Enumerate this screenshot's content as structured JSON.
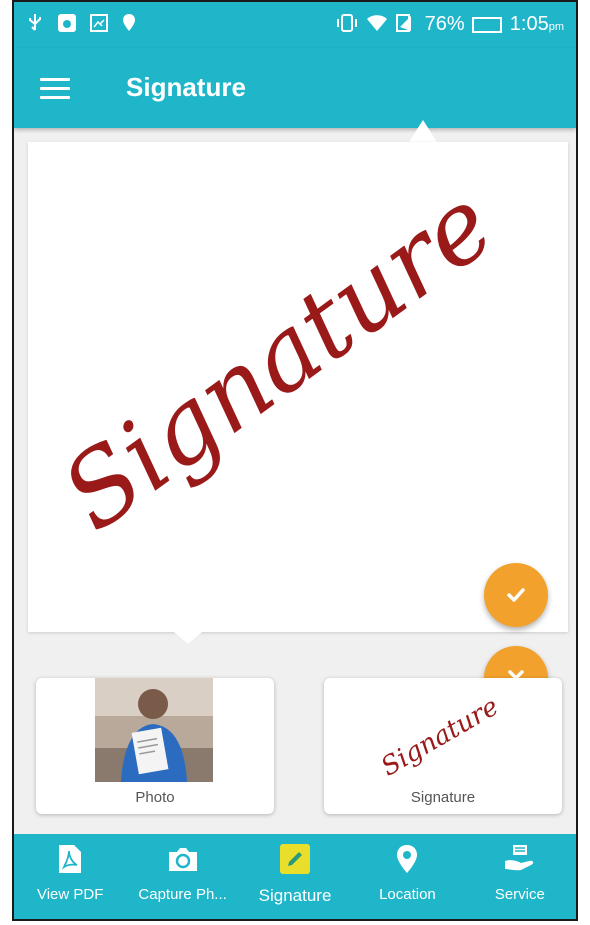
{
  "status_bar": {
    "battery": "76%",
    "time": "1:05",
    "ampm": "pm"
  },
  "toolbar": {
    "title": "Signature"
  },
  "signature_pad": {
    "signature_text": "Signature"
  },
  "thumbnails": [
    {
      "label": "Photo"
    },
    {
      "label": "Signature",
      "signature_text": "Signature"
    }
  ],
  "bottom_nav": {
    "items": [
      {
        "label": "View PDF",
        "icon": "pdf-icon"
      },
      {
        "label": "Capture Ph...",
        "icon": "camera-icon"
      },
      {
        "label": "Signature",
        "icon": "pencil-icon",
        "active": true
      },
      {
        "label": "Location",
        "icon": "location-pin-icon"
      },
      {
        "label": "Service",
        "icon": "service-hand-icon"
      }
    ]
  },
  "colors": {
    "primary": "#20b6ca",
    "fab": "#f2a22c",
    "active_icon": "#e9df2a",
    "signature_ink": "#9a1a1a"
  }
}
